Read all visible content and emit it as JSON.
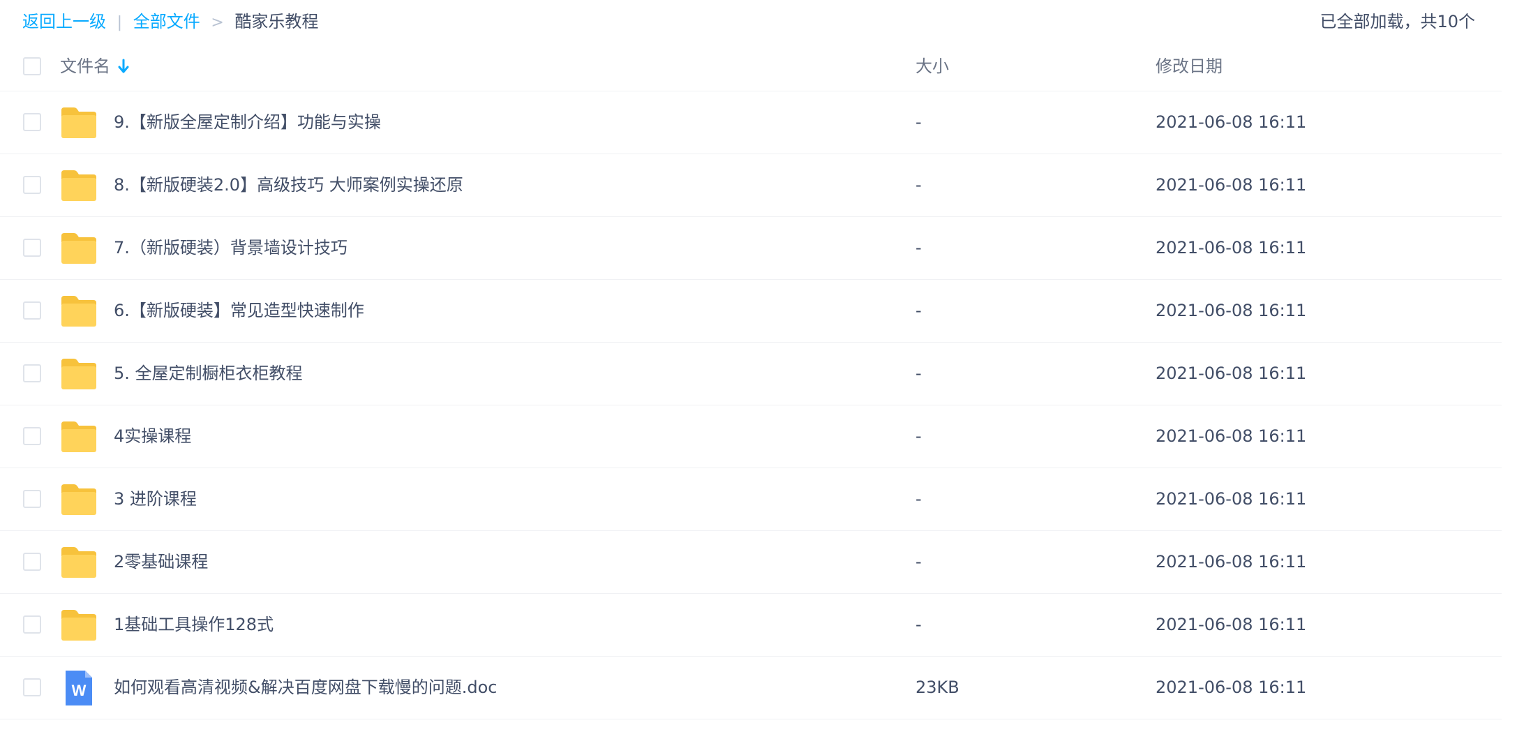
{
  "breadcrumb": {
    "back": "返回上一级",
    "divider": "|",
    "all_files": "全部文件",
    "separator": ">",
    "current": "酷家乐教程"
  },
  "load_status": "已全部加载，共10个",
  "table": {
    "headers": {
      "name": "文件名",
      "size": "大小",
      "date": "修改日期"
    },
    "sort_icon": "arrow-down-icon",
    "rows": [
      {
        "type": "folder",
        "name": "9.【新版全屋定制介绍】功能与实操",
        "size": "-",
        "date": "2021-06-08 16:11"
      },
      {
        "type": "folder",
        "name": "8.【新版硬装2.0】高级技巧 大师案例实操还原",
        "size": "-",
        "date": "2021-06-08 16:11"
      },
      {
        "type": "folder",
        "name": "7.（新版硬装）背景墙设计技巧",
        "size": "-",
        "date": "2021-06-08 16:11"
      },
      {
        "type": "folder",
        "name": "6.【新版硬装】常见造型快速制作",
        "size": "-",
        "date": "2021-06-08 16:11"
      },
      {
        "type": "folder",
        "name": "5. 全屋定制橱柜衣柜教程",
        "size": "-",
        "date": "2021-06-08 16:11"
      },
      {
        "type": "folder",
        "name": "4实操课程",
        "size": "-",
        "date": "2021-06-08 16:11"
      },
      {
        "type": "folder",
        "name": "3 进阶课程",
        "size": "-",
        "date": "2021-06-08 16:11"
      },
      {
        "type": "folder",
        "name": "2零基础课程",
        "size": "-",
        "date": "2021-06-08 16:11"
      },
      {
        "type": "folder",
        "name": "1基础工具操作128式",
        "size": "-",
        "date": "2021-06-08 16:11"
      },
      {
        "type": "doc",
        "name": "如何观看高清视频&解决百度网盘下载慢的问题.doc",
        "size": "23KB",
        "date": "2021-06-08 16:11"
      }
    ]
  },
  "colors": {
    "link": "#09aaff",
    "text": "#424e67",
    "folder": "#ffd35a",
    "folder_dark": "#f7c23c",
    "doc": "#4b8cf5"
  }
}
